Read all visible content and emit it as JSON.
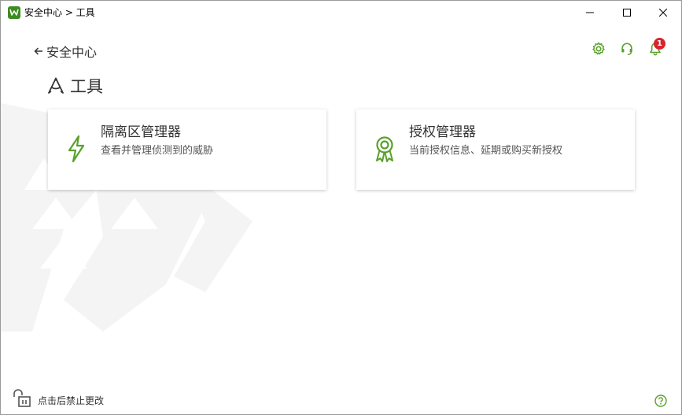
{
  "window": {
    "title": "安全中心 > 工具",
    "app_icon": "drweb-spider-icon"
  },
  "header": {
    "back_label": "安全中心",
    "notification_count": "1",
    "icons": [
      "gear-icon",
      "headset-icon",
      "bell-icon"
    ]
  },
  "page": {
    "title": "工具",
    "title_icon": "tools-icon"
  },
  "cards": [
    {
      "title": "隔离区管理器",
      "description": "查看并管理侦测到的威胁",
      "icon": "lightning-icon"
    },
    {
      "title": "授权管理器",
      "description": "当前授权信息、延期或购买新授权",
      "icon": "award-ribbon-icon"
    }
  ],
  "footer": {
    "lock_label": "点击后禁止更改",
    "icons": [
      "lock-icon",
      "help-icon"
    ]
  },
  "colors": {
    "accent": "#5aa02c",
    "badge": "#d9232d",
    "text": "#333333"
  }
}
